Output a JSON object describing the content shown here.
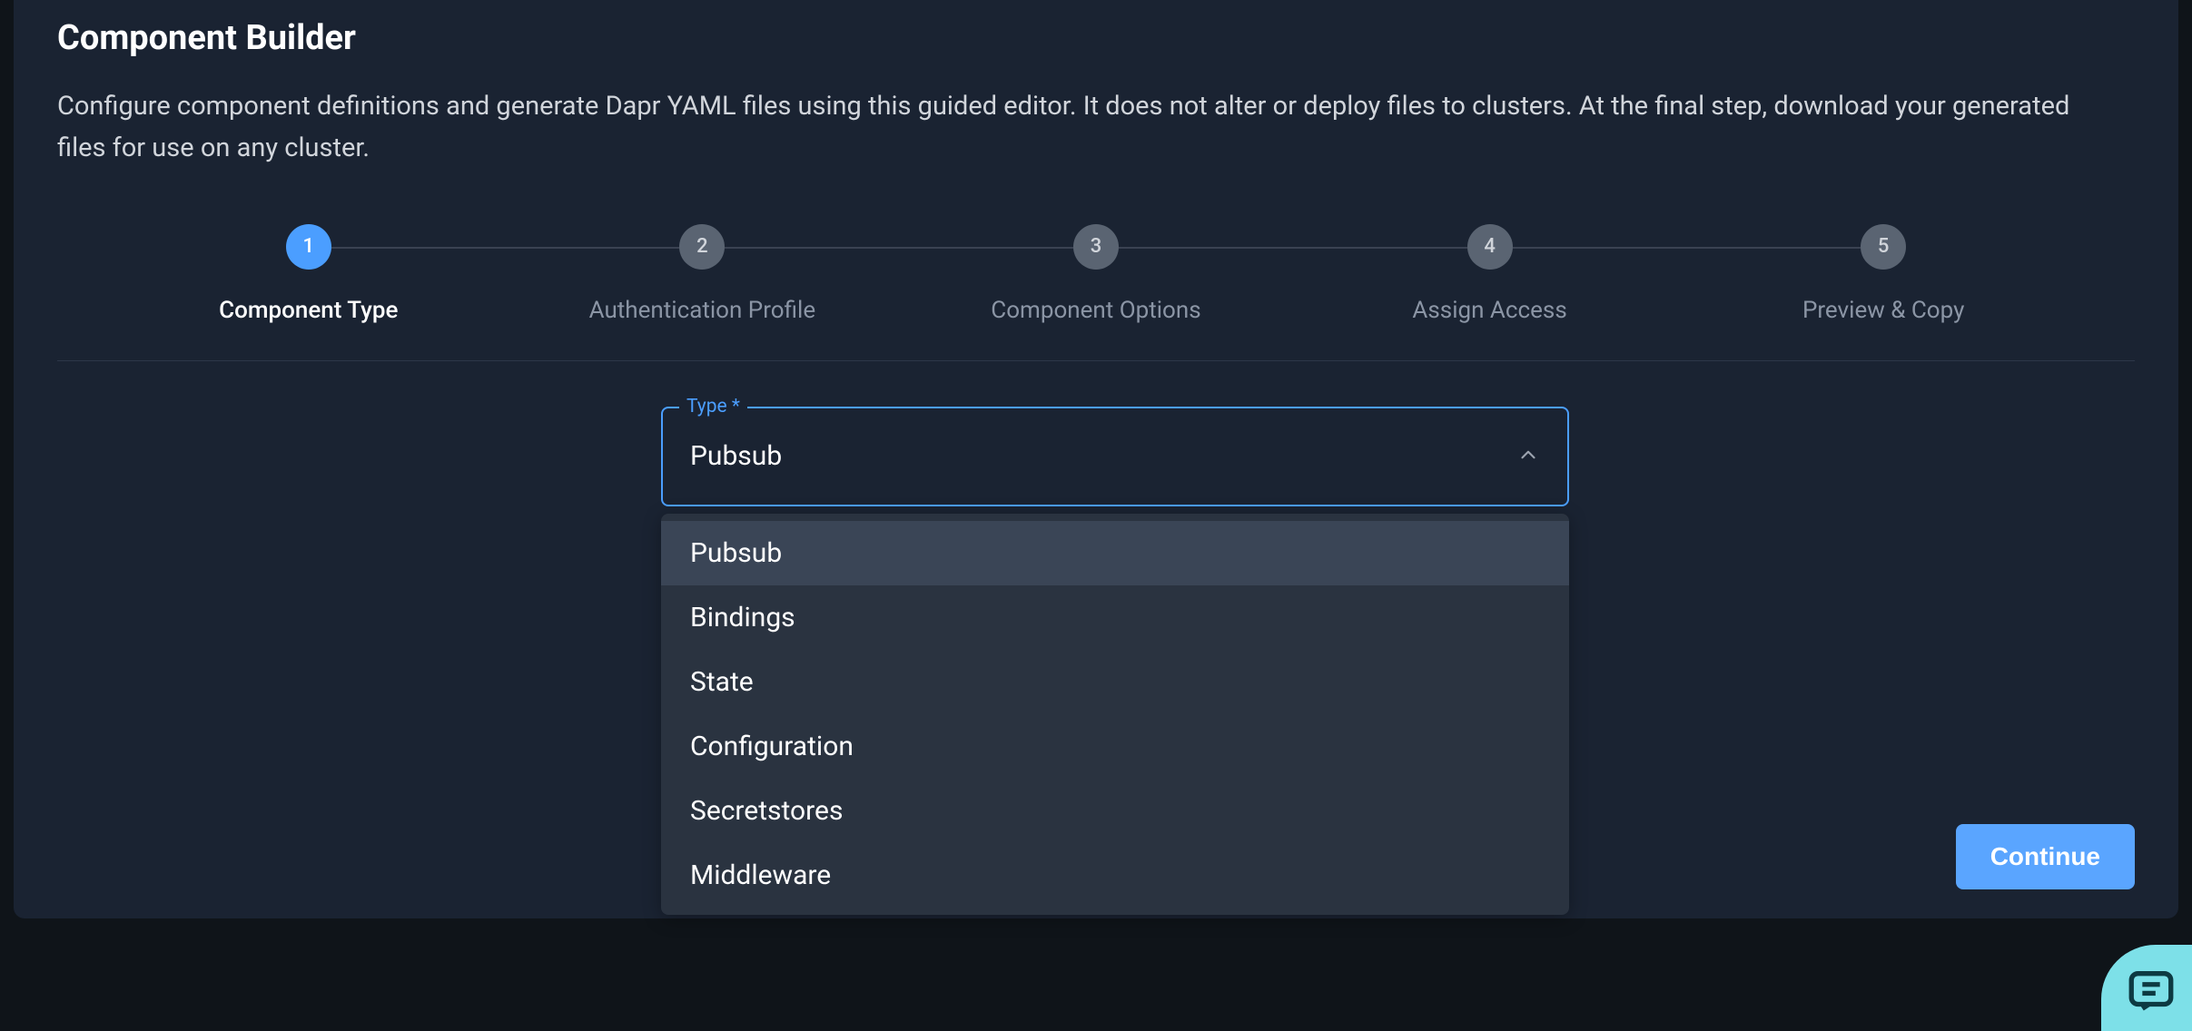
{
  "header": {
    "title": "Component Builder",
    "description": "Configure component definitions and generate Dapr YAML files using this guided editor. It does not alter or deploy files to clusters. At the final step, download your generated files for use on any cluster."
  },
  "stepper": {
    "steps": [
      {
        "number": "1",
        "label": "Component Type",
        "active": true
      },
      {
        "number": "2",
        "label": "Authentication Profile",
        "active": false
      },
      {
        "number": "3",
        "label": "Component Options",
        "active": false
      },
      {
        "number": "4",
        "label": "Assign Access",
        "active": false
      },
      {
        "number": "5",
        "label": "Preview & Copy",
        "active": false
      }
    ]
  },
  "form": {
    "type_label": "Type *",
    "type_value": "Pubsub",
    "type_options": [
      "Pubsub",
      "Bindings",
      "State",
      "Configuration",
      "Secretstores",
      "Middleware"
    ]
  },
  "actions": {
    "continue_label": "Continue"
  },
  "icons": {
    "chevron_up": "chevron-up-icon",
    "chat": "chat-icon"
  },
  "colors": {
    "accent": "#4b9eff",
    "panel_bg": "#1a2332",
    "body_bg": "#0f1419",
    "fab_bg": "#7de0e8"
  }
}
